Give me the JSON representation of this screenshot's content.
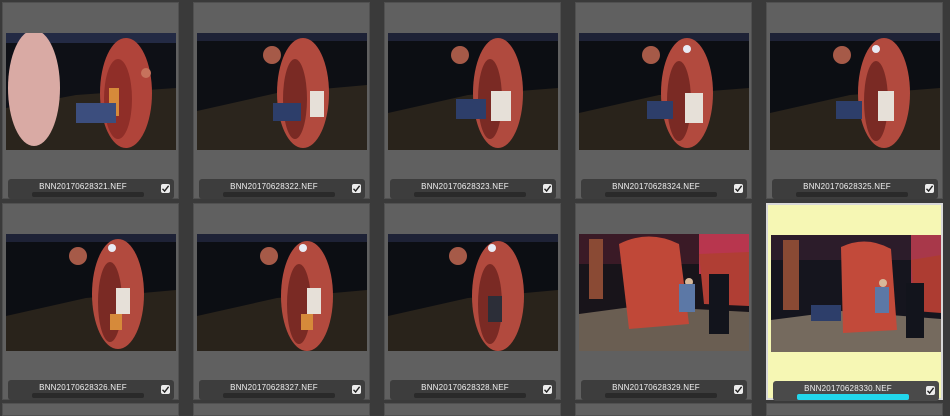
{
  "grid": {
    "cells": [
      {
        "filename": "BNN20170628321.NEF",
        "checked": true,
        "selected": false
      },
      {
        "filename": "BNN20170628322.NEF",
        "checked": true,
        "selected": false
      },
      {
        "filename": "BNN20170628323.NEF",
        "checked": true,
        "selected": false
      },
      {
        "filename": "BNN20170628324.NEF",
        "checked": true,
        "selected": false
      },
      {
        "filename": "BNN20170628325.NEF",
        "checked": true,
        "selected": false
      },
      {
        "filename": "BNN20170628326.NEF",
        "checked": true,
        "selected": false
      },
      {
        "filename": "BNN20170628327.NEF",
        "checked": true,
        "selected": false
      },
      {
        "filename": "BNN20170628328.NEF",
        "checked": true,
        "selected": false
      },
      {
        "filename": "BNN20170628329.NEF",
        "checked": true,
        "selected": false
      },
      {
        "filename": "BNN20170628330.NEF",
        "checked": true,
        "selected": true
      }
    ]
  },
  "colors": {
    "selected_background": "#f6f7b4",
    "selected_rating_bar": "#22d7ec",
    "cell_background": "#606060",
    "app_background": "#3a3a3a"
  },
  "icons": [
    "photo-thumbnail",
    "check-icon"
  ]
}
